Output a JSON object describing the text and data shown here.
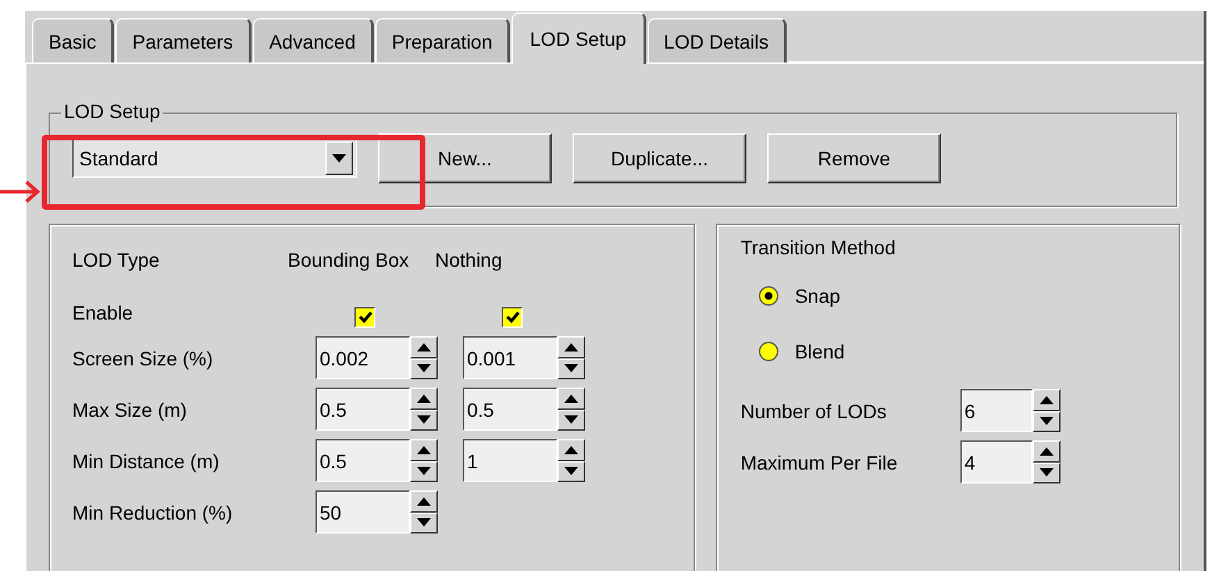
{
  "tabs": [
    {
      "label": "Basic",
      "selected": false
    },
    {
      "label": "Parameters",
      "selected": false
    },
    {
      "label": "Advanced",
      "selected": false
    },
    {
      "label": "Preparation",
      "selected": false
    },
    {
      "label": "LOD Setup",
      "selected": true
    },
    {
      "label": "LOD Details",
      "selected": false
    }
  ],
  "lod_setup": {
    "title": "LOD Setup",
    "profile": "Standard",
    "buttons": [
      "New...",
      "Duplicate...",
      "Remove"
    ]
  },
  "lod_types": {
    "header_label": "LOD Type",
    "columns": [
      "Bounding Box",
      "Nothing"
    ],
    "enable": {
      "label": "Enable",
      "checks": [
        {
          "checked": true
        },
        {
          "checked": true
        }
      ]
    },
    "rows": [
      {
        "label": "Screen Size (%)",
        "values": [
          "0.002",
          "0.001"
        ]
      },
      {
        "label": "Max Size (m)",
        "values": [
          "0.5",
          "0.5"
        ]
      },
      {
        "label": "Min Distance (m)",
        "values": [
          "0.5",
          "1"
        ]
      },
      {
        "label": "Min Reduction (%)",
        "values": [
          "50"
        ]
      }
    ]
  },
  "transition": {
    "title": "Transition Method",
    "options": [
      {
        "label": "Snap",
        "selected": true
      },
      {
        "label": "Blend",
        "selected": false
      }
    ],
    "fields": [
      {
        "label": "Number of LODs",
        "value": "6"
      },
      {
        "label": "Maximum Per File",
        "value": "4"
      }
    ]
  }
}
